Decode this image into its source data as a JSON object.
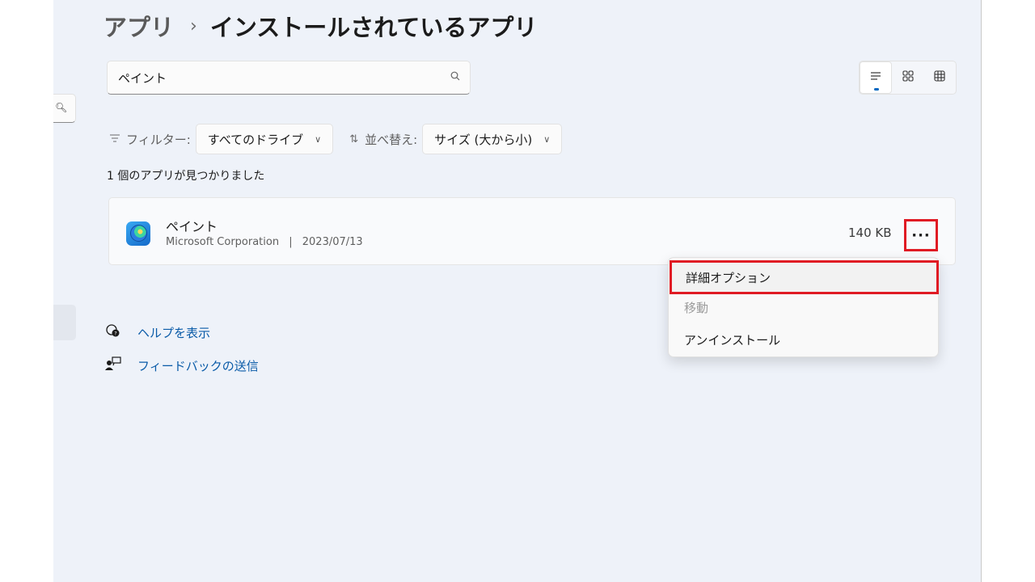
{
  "breadcrumb": {
    "parent": "アプリ",
    "separator": "›",
    "current": "インストールされているアプリ"
  },
  "search": {
    "value": "ペイント",
    "icon": "search-icon"
  },
  "view_toggle": {
    "icons": [
      "list-view-icon",
      "grid-view-icon",
      "table-view-icon"
    ],
    "active": "list-view-icon"
  },
  "filter": {
    "label": "フィルター:",
    "value": "すべてのドライブ",
    "icon": "filter-icon"
  },
  "sort": {
    "label": "並べ替え:",
    "value": "サイズ (大から小)",
    "icon": "sort-icon"
  },
  "result_count": "1 個のアプリが見つかりました",
  "app": {
    "name": "ペイント",
    "publisher": "Microsoft Corporation",
    "separator": "|",
    "date": "2023/07/13",
    "size": "140 KB",
    "more_label": "···"
  },
  "context_menu": {
    "advanced_options": "詳細オプション",
    "move": "移動",
    "uninstall": "アンインストール"
  },
  "help": {
    "get_help": "ヘルプを表示",
    "feedback": "フィードバックの送信"
  },
  "colors": {
    "accent": "#0067c0",
    "highlight": "#e01b24",
    "link": "#0a5ba8",
    "background": "#eef2f9"
  }
}
